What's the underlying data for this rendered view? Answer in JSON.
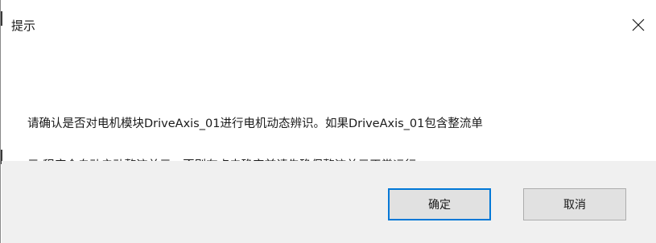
{
  "window": {
    "title": "提示",
    "close_icon": "close-icon"
  },
  "message": {
    "line1": "请确认是否对电机模块DriveAxis_01进行电机动态辨识。如果DriveAxis_01包含整流单",
    "line2": "元,程序会自动启动整流单元。否则在点击确定前请先确保整流单元正常运行"
  },
  "buttons": {
    "ok_label": "确定",
    "cancel_label": "取消"
  },
  "colors": {
    "focus_border": "#0078d7",
    "footer_bg": "#f0f0f0",
    "button_bg": "#e1e1e1"
  }
}
